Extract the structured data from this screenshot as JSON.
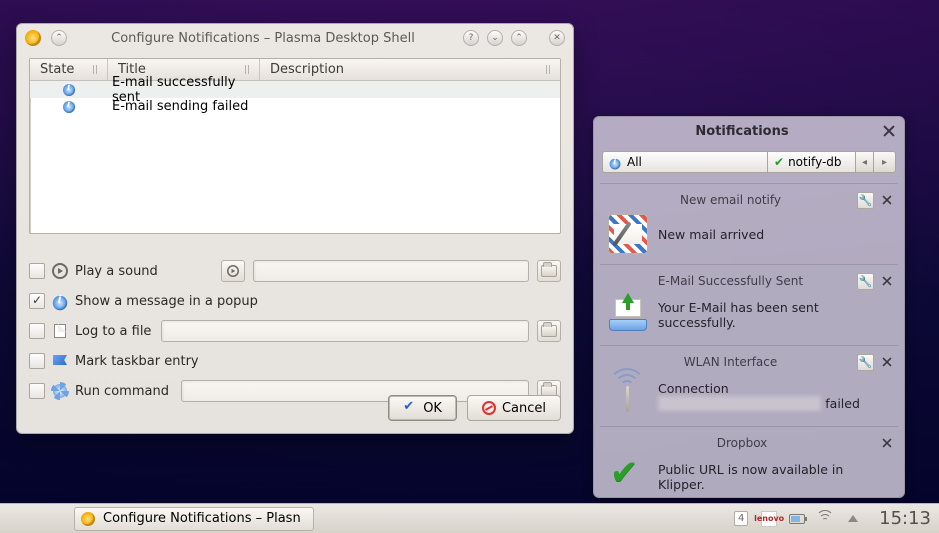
{
  "cfg": {
    "title": "Configure Notifications – Plasma Desktop Shell",
    "columns": {
      "state": "State",
      "title": "Title",
      "desc": "Description"
    },
    "rows": [
      {
        "title": "E-mail successfully sent"
      },
      {
        "title": "E-mail sending failed"
      }
    ],
    "actions": {
      "play_sound": "Play a sound",
      "popup": "Show a message in a popup",
      "log": "Log to a file",
      "taskbar": "Mark taskbar entry",
      "run": "Run command"
    },
    "ok": "OK",
    "cancel": "Cancel"
  },
  "panel": {
    "title": "Notifications",
    "filter_all": "All",
    "filter_src": "notify-db",
    "items": [
      {
        "title": "New email notify",
        "body": "New mail arrived",
        "showWrench": true
      },
      {
        "title": "E-Mail Successfully Sent",
        "body": "Your E-Mail has been sent successfully.",
        "showWrench": true
      },
      {
        "title": "WLAN Interface",
        "body_pre": "Connection ",
        "body_blur": "l",
        "body_post": " failed",
        "showWrench": true
      },
      {
        "title": "Dropbox",
        "body": "Public URL is now available in Klipper.",
        "showWrench": false
      }
    ]
  },
  "taskbar": {
    "entry": "Configure Notifications – Plasn",
    "kbd": "4",
    "brand": "lenovo",
    "clock": "15:13"
  }
}
